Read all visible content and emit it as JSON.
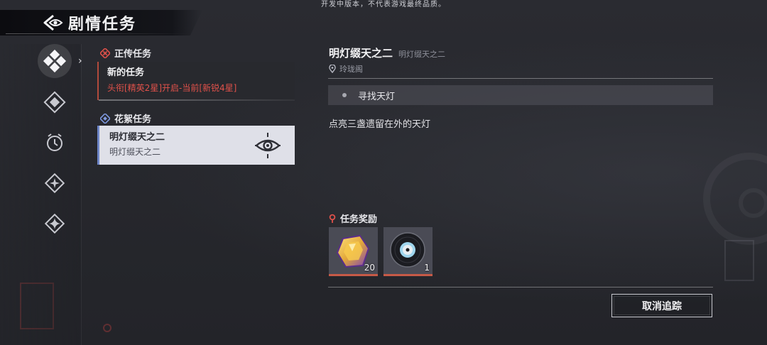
{
  "watermark": "开发中版本，不代表游戏最终品质。",
  "header": {
    "title": "剧情任务"
  },
  "categories": [
    {
      "icon": "four-diamond-icon",
      "active": true
    },
    {
      "icon": "compass-diamond-icon",
      "active": false
    },
    {
      "icon": "clock-icon",
      "active": false
    },
    {
      "icon": "diamond-star-icon",
      "active": false
    },
    {
      "icon": "sparkle-icon",
      "active": false
    }
  ],
  "quest_list": {
    "main_section": {
      "label": "正传任务",
      "quests": [
        {
          "name": "新的任务",
          "status": "头衔[精英2星]开启-当前[新锐4星]"
        }
      ]
    },
    "side_section": {
      "label": "花絮任务",
      "quests": [
        {
          "name": "明灯缀天之二",
          "subtitle": "明灯缀天之二",
          "tracked": true
        }
      ]
    }
  },
  "detail": {
    "title": "明灯缀天之二",
    "subtitle": "明灯缀天之二",
    "location": "玲珑阁",
    "objective": "寻找天灯",
    "description": "点亮三盏遗留在外的天灯",
    "rewards_label": "任务奖励",
    "rewards": [
      {
        "icon": "gold-gem-icon",
        "count": "20"
      },
      {
        "icon": "music-disc-icon",
        "count": "1"
      }
    ],
    "cancel_track_label": "取消追踪"
  },
  "colors": {
    "accent_red": "#e0514a",
    "tracked_blue": "#6e86c8",
    "reward_bar": "#c75a47"
  }
}
